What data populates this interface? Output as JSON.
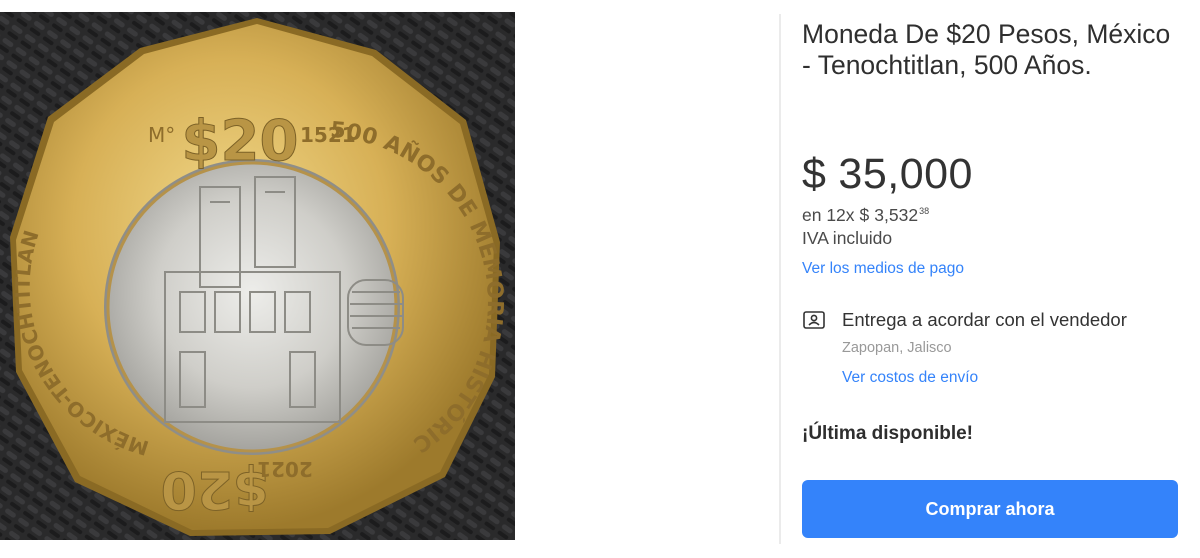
{
  "product": {
    "title": "Moneda De $20 Pesos, México - Tenochtitlan, 500 Años.",
    "image_alt": "Moneda bimetálica de $20 pesos Tenochtitlan 500 años",
    "coin_texts": {
      "denomination": "$20",
      "mint_mark": "M°",
      "year_top": "1521",
      "legend_right": "500 AÑOS DE MEMORIA HISTÓRICA",
      "legend_left": "MÉXICO-TENOCHTITLAN",
      "year_bottom": "2021",
      "denomination_bottom": "$20"
    }
  },
  "price": {
    "currency": "$",
    "amount": "35,000"
  },
  "installments": {
    "prefix": "en 12x",
    "currency": "$",
    "amount": "3,532",
    "cents": "38"
  },
  "tax_note": "IVA incluido",
  "payment_link": "Ver los medios de pago",
  "shipping": {
    "icon": "delivery-agreement-icon",
    "text": "Entrega a acordar con el vendedor",
    "location": "Zapopan, Jalisco",
    "cost_link": "Ver costos de envío"
  },
  "stock_label": "¡Última disponible!",
  "buy_button": "Comprar ahora",
  "colors": {
    "accent": "#3483fa",
    "title_text": "#2f2f2f",
    "secondary_text": "#999999"
  }
}
